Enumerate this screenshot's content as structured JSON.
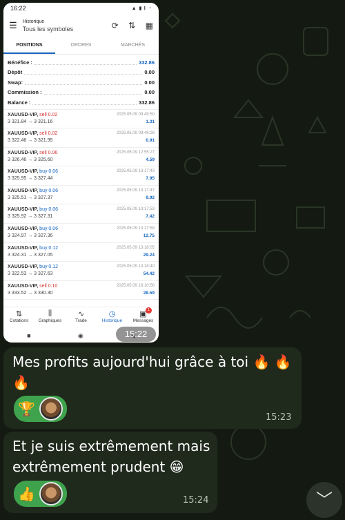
{
  "screenshot": {
    "status_time": "16:22",
    "status_icons": "▲ ▮ 𝄃 ◔",
    "app_bar": {
      "title": "Historique",
      "subtitle": "Tous les symboles"
    },
    "tabs": [
      {
        "label": "POSITIONS"
      },
      {
        "label": "ORDRES"
      },
      {
        "label": "MARCHÉS"
      }
    ],
    "summary": [
      {
        "label": "Bénéfice :",
        "value": "332.86"
      },
      {
        "label": "Dépôt",
        "value": "0.00"
      },
      {
        "label": "Swap:",
        "value": "0.00"
      },
      {
        "label": "Commission :",
        "value": "0.00"
      },
      {
        "label": "Balance :",
        "value": "332.86"
      }
    ],
    "trades": [
      {
        "symbol": "XAUUSD-VIP,",
        "direction": "sell 0.02",
        "prices": "3 321.84 → 3 321.16",
        "time": "2025.05.09 09:49:50",
        "profit": "1.31"
      },
      {
        "symbol": "XAUUSD-VIP,",
        "direction": "sell 0.02",
        "prices": "3 322.46 → 3 321.95",
        "time": "2025.05.09 09:49:26",
        "profit": "0.91"
      },
      {
        "symbol": "XAUUSD-VIP,",
        "direction": "sell 0.06",
        "prices": "3 326.46 → 3 325.60",
        "time": "2025.05.09 12:55:27",
        "profit": "4.59"
      },
      {
        "symbol": "XAUUSD-VIP,",
        "direction": "buy 0.06",
        "prices": "3 325.95 → 3 327.44",
        "time": "2025.05.09 13:17:43",
        "profit": "7.95"
      },
      {
        "symbol": "XAUUSD-VIP,",
        "direction": "buy 0.06",
        "prices": "3 325.51 → 3 327.37",
        "time": "2025.05.09 13:17:47",
        "profit": "9.92"
      },
      {
        "symbol": "XAUUSD-VIP,",
        "direction": "buy 0.06",
        "prices": "3 325.92 → 3 327.31",
        "time": "2025.05.09 13:17:53",
        "profit": "7.42"
      },
      {
        "symbol": "XAUUSD-VIP,",
        "direction": "buy 0.06",
        "prices": "3 324.97 → 3 327.36",
        "time": "2025.05.09 13:17:59",
        "profit": "12.75"
      },
      {
        "symbol": "XAUUSD-VIP,",
        "direction": "buy 0.12",
        "prices": "3 324.31 → 3 327.05",
        "time": "2025.05.09 13:18:05",
        "profit": "29.24"
      },
      {
        "symbol": "XAUUSD-VIP,",
        "direction": "buy 0.12",
        "prices": "3 322.53 → 3 327.63",
        "time": "2025.05.09 13:18:40",
        "profit": "54.42"
      },
      {
        "symbol": "XAUUSD-VIP,",
        "direction": "sell 0.10",
        "prices": "3 333.52 → 3 330.30",
        "time": "2025.05.09 16:10:56",
        "profit": "28.59"
      }
    ],
    "bottom_nav": [
      {
        "label": "Cotations",
        "icon": "⇅"
      },
      {
        "label": "Graphiques",
        "icon": "⫼"
      },
      {
        "label": "Trade",
        "icon": "∿"
      },
      {
        "label": "Historique",
        "icon": "◷"
      },
      {
        "label": "Messages",
        "icon": "▣",
        "badge": "1"
      }
    ],
    "system_nav": {
      "back": "■",
      "home": "◉",
      "recents": "◀"
    }
  },
  "message_1": {
    "time": "15:22"
  },
  "message_2": {
    "text": "Mes profits aujourd'hui grâce à toi 🔥 🔥 🔥",
    "reaction_emoji": "🏆",
    "time": "15:23"
  },
  "message_3": {
    "text": "Et je suis extrêmement mais extrêmement prudent 😁",
    "reaction_emoji": "👍",
    "time": "15:24"
  },
  "scroll_down_icon": "﹀",
  "colors": {
    "accent": "#1565c0",
    "sell": "#d32f2f",
    "reaction": "#3fa34d",
    "bubble": "#1f2a1c",
    "background": "#141a12"
  }
}
